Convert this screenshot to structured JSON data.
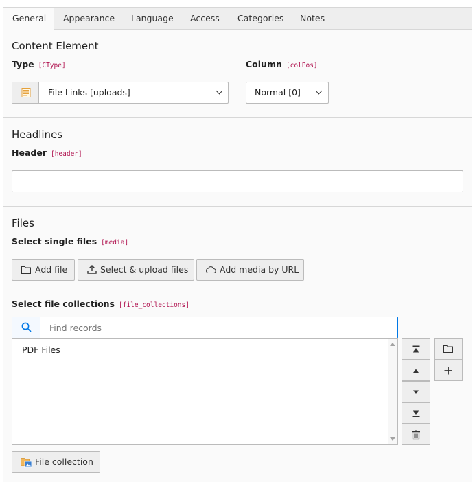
{
  "tabs": [
    "General",
    "Appearance",
    "Language",
    "Access",
    "Categories",
    "Notes"
  ],
  "content_element": {
    "title": "Content Element",
    "type": {
      "label": "Type",
      "code": "[CType]",
      "value": "File Links [uploads]",
      "icon": "file-links-icon"
    },
    "column": {
      "label": "Column",
      "code": "[colPos]",
      "value": "Normal [0]"
    }
  },
  "headlines": {
    "title": "Headlines",
    "header": {
      "label": "Header",
      "code": "[header]",
      "value": ""
    }
  },
  "files": {
    "title": "Files",
    "media": {
      "label": "Select single files",
      "code": "[media]",
      "buttons": {
        "add_file": "Add file",
        "select_upload": "Select & upload files",
        "add_media_url": "Add media by URL"
      }
    },
    "collections": {
      "label": "Select file collections",
      "code": "[file_collections]",
      "search_placeholder": "Find records",
      "items": [
        "PDF Files"
      ],
      "add_button": "File collection"
    }
  },
  "colors": {
    "accent": "#0078e6",
    "code": "#b0114e",
    "tab_bg": "#eeeeee",
    "border": "#bbbbbb"
  }
}
